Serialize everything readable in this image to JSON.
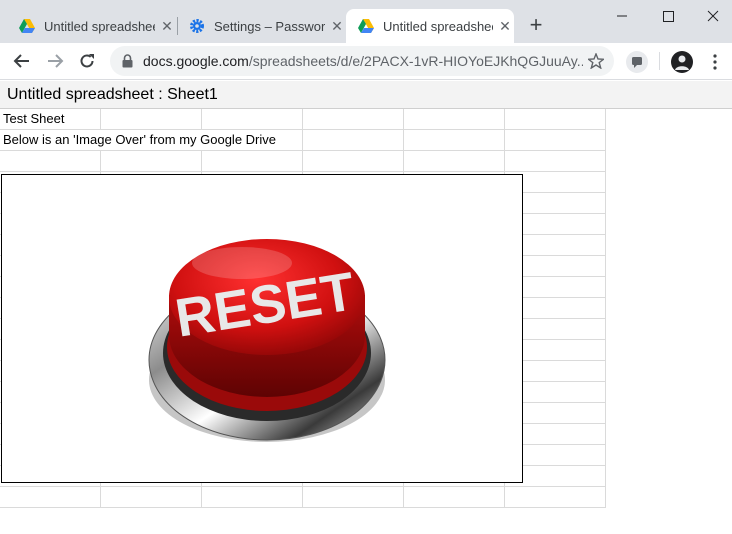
{
  "tabs": [
    {
      "title": "Untitled spreadsheet",
      "icon": "google-sheets-icon",
      "active": false
    },
    {
      "title": "Settings – Passwords",
      "icon": "settings-gear-icon",
      "active": false
    },
    {
      "title": "Untitled spreadsheet",
      "icon": "google-sheets-icon",
      "active": true
    }
  ],
  "address": {
    "host": "docs.google.com",
    "path": "/spreadsheets/d/e/2PACX-1vR-HIOYoEJKhQGJuuAy..."
  },
  "sheet": {
    "title": "Untitled spreadsheet : Sheet1",
    "cells": {
      "a1": "Test Sheet",
      "a2": "Below is an 'Image Over' from my Google Drive"
    }
  },
  "image": {
    "label": "RESET",
    "button_color": "#cc1111"
  },
  "colors": {
    "tabstrip": "#dee1e6",
    "gridline": "#dadada",
    "sheets_green": "#0f9d58",
    "settings_blue": "#1a73e8"
  }
}
